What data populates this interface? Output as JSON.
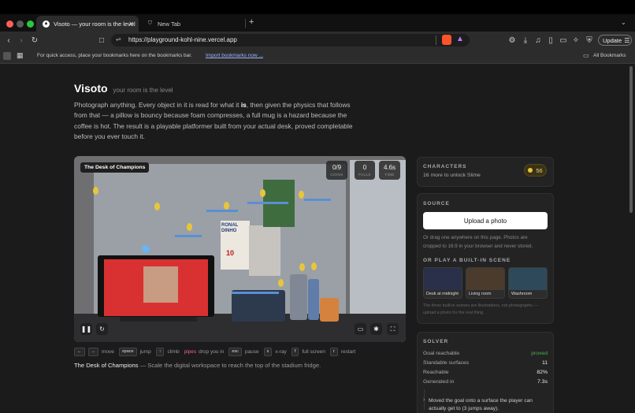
{
  "browser": {
    "tabs": [
      {
        "title": "Visoto — your room is the level",
        "active": true
      },
      {
        "title": "New Tab",
        "active": false
      }
    ],
    "url": "https://playground-kohl-nine.vercel.app",
    "update_label": "Update",
    "bookmarks_hint": "For quick access, place your bookmarks here on the bookmarks bar.",
    "bookmarks_import": "Import bookmarks now ...",
    "all_bookmarks": "All Bookmarks",
    "colors": {
      "close": "#ff5f57",
      "min": "#febc2e",
      "max": "#28c840",
      "brave": "#fb542b"
    }
  },
  "hero": {
    "title": "Visoto",
    "tagline": "your room is the level",
    "desc_before": "Photograph anything. Every object in it is read for what it ",
    "desc_em": "is",
    "desc_after": ", then given the physics that follows from that — a pillow is bouncy because foam compresses, a full mug is a hazard because the coffee is hot. The result is a playable platformer built from your actual desk, proved completable before you ever touch it."
  },
  "game": {
    "scene_label": "The Desk of Champions",
    "stats": [
      {
        "value": "0/9",
        "label": "COINS"
      },
      {
        "value": "0",
        "label": "FALLS"
      },
      {
        "value": "4.6s",
        "label": "TIME"
      }
    ],
    "poster_text": "RONAL DINHO",
    "poster_number": "10"
  },
  "keys": [
    {
      "key": "←",
      "label": ""
    },
    {
      "key": "→",
      "label": "move"
    },
    {
      "key": "space",
      "label": "jump"
    },
    {
      "key": "↑",
      "label": "climb"
    },
    {
      "key": "pipes",
      "label": "drop you in",
      "accent": true
    },
    {
      "key": "esc",
      "label": "pause"
    },
    {
      "key": "x",
      "label": "x-ray"
    },
    {
      "key": "f",
      "label": "full screen"
    },
    {
      "key": "r",
      "label": "restart"
    }
  ],
  "caption": {
    "title": "The Desk of Champions",
    "text": " — Scale the digital workspace to reach the top of the stadium fridge."
  },
  "characters": {
    "title": "CHARACTERS",
    "subtitle": "16 more to unlock Slime",
    "count": "56"
  },
  "source": {
    "title": "SOURCE",
    "upload_label": "Upload a photo",
    "hint": "Or drag one anywhere on this page. Photos are cropped to 16:9 in your browser and never stored.",
    "builtin_title": "OR PLAY A BUILT-IN SCENE",
    "scenes": [
      "Desk at midnight",
      "Living room",
      "Washroom"
    ],
    "scenes_note": "The three built-in scenes are illustrations, not photographs — upload a photo for the real thing."
  },
  "solver": {
    "title": "SOLVER",
    "rows": [
      {
        "label": "Goal reachable",
        "value": "proved"
      },
      {
        "label": "Standable surfaces",
        "value": "11"
      },
      {
        "label": "Reachable",
        "value": "82%"
      },
      {
        "label": "Generated in",
        "value": "7.3s"
      }
    ],
    "note": "Moved the goal onto a surface the player can actually get to (3 jumps away).",
    "colors": {
      "proved": "#4caf50"
    }
  }
}
